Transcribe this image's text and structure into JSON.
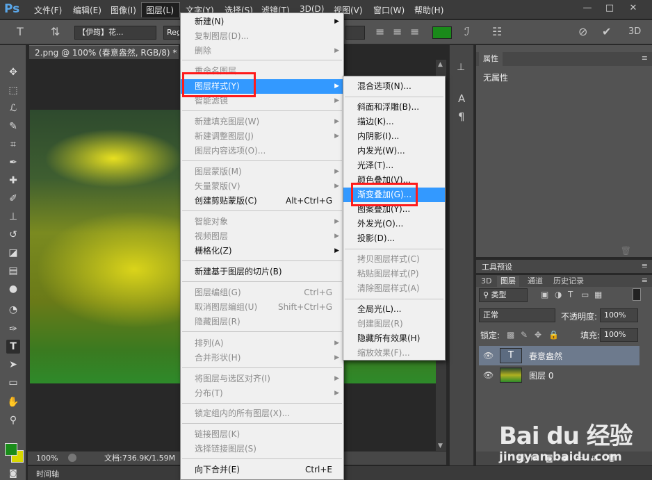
{
  "app": {
    "logo": "Ps"
  },
  "menubar": {
    "items": [
      "文件(F)",
      "编辑(E)",
      "图像(I)",
      "图层(L)",
      "文字(Y)",
      "选择(S)",
      "滤镜(T)",
      "3D(D)",
      "视图(V)",
      "窗口(W)",
      "帮助(H)"
    ],
    "window_controls": [
      "—",
      "□",
      "✕"
    ]
  },
  "options": {
    "font_family": "【伊筠】花...",
    "font_style": "Reg",
    "text_color": "#1a8a1a"
  },
  "document": {
    "tab_title": "2.png @ 100% (春意盎然, RGB/8) *",
    "tab_close": "×",
    "zoom": "100%",
    "doc_info": "文档:736.9K/1.59M"
  },
  "colors": {
    "foreground": "#1a8c1a",
    "background": "#d8d800"
  },
  "properties": {
    "tab": "属性",
    "empty_text": "无属性"
  },
  "tool_presets": {
    "label": "工具预设"
  },
  "layers_panel": {
    "tabs": [
      "3D",
      "图层",
      "通道",
      "历史记录"
    ],
    "active_tab": "图层",
    "filter_kind": "类型",
    "blend_mode": "正常",
    "opacity_label": "不透明度:",
    "opacity_value": "100%",
    "lock_label": "锁定:",
    "fill_label": "填充:",
    "fill_value": "100%",
    "layers": [
      {
        "name": "春意盎然",
        "type": "text",
        "thumb_glyph": "T",
        "selected": true
      },
      {
        "name": "图层 0",
        "type": "image",
        "selected": false
      }
    ]
  },
  "timeline": {
    "label": "时间轴"
  },
  "layer_menu": {
    "items": [
      {
        "label": "新建(N)",
        "submenu": true
      },
      {
        "label": "复制图层(D)...",
        "disabled": true
      },
      {
        "label": "删除",
        "disabled": true,
        "submenu": true
      },
      {
        "label": "重命名图层...",
        "disabled": true
      },
      {
        "label": "图层样式(Y)",
        "submenu": true,
        "highlighted": true
      },
      {
        "label": "智能滤镜",
        "disabled": true,
        "submenu": true
      },
      {
        "label": "新建填充图层(W)",
        "disabled": true,
        "submenu": true
      },
      {
        "label": "新建调整图层(J)",
        "disabled": true,
        "submenu": true
      },
      {
        "label": "图层内容选项(O)...",
        "disabled": true
      },
      {
        "label": "图层蒙版(M)",
        "disabled": true,
        "submenu": true
      },
      {
        "label": "矢量蒙版(V)",
        "disabled": true,
        "submenu": true
      },
      {
        "label": "创建剪贴蒙版(C)",
        "shortcut": "Alt+Ctrl+G"
      },
      {
        "label": "智能对象",
        "disabled": true,
        "submenu": true
      },
      {
        "label": "视频图层",
        "disabled": true,
        "submenu": true
      },
      {
        "label": "栅格化(Z)",
        "submenu": true
      },
      {
        "label": "新建基于图层的切片(B)"
      },
      {
        "label": "图层编组(G)",
        "disabled": true,
        "shortcut": "Ctrl+G"
      },
      {
        "label": "取消图层编组(U)",
        "disabled": true,
        "shortcut": "Shift+Ctrl+G"
      },
      {
        "label": "隐藏图层(R)",
        "disabled": true
      },
      {
        "label": "排列(A)",
        "disabled": true,
        "submenu": true
      },
      {
        "label": "合并形状(H)",
        "disabled": true,
        "submenu": true
      },
      {
        "label": "将图层与选区对齐(I)",
        "disabled": true,
        "submenu": true
      },
      {
        "label": "分布(T)",
        "disabled": true,
        "submenu": true
      },
      {
        "label": "锁定组内的所有图层(X)...",
        "disabled": true
      },
      {
        "label": "链接图层(K)",
        "disabled": true
      },
      {
        "label": "选择链接图层(S)",
        "disabled": true
      },
      {
        "label": "向下合并(E)",
        "shortcut": "Ctrl+E"
      }
    ]
  },
  "style_submenu": {
    "items": [
      {
        "label": "混合选项(N)..."
      },
      {
        "label": "斜面和浮雕(B)..."
      },
      {
        "label": "描边(K)..."
      },
      {
        "label": "内阴影(I)..."
      },
      {
        "label": "内发光(W)..."
      },
      {
        "label": "光泽(T)..."
      },
      {
        "label": "颜色叠加(V)..."
      },
      {
        "label": "渐变叠加(G)...",
        "highlighted": true
      },
      {
        "label": "图案叠加(Y)..."
      },
      {
        "label": "外发光(O)..."
      },
      {
        "label": "投影(D)..."
      },
      {
        "label": "拷贝图层样式(C)",
        "disabled": true
      },
      {
        "label": "粘贴图层样式(P)",
        "disabled": true
      },
      {
        "label": "清除图层样式(A)",
        "disabled": true
      },
      {
        "label": "全局光(L)..."
      },
      {
        "label": "创建图层(R)",
        "disabled": true
      },
      {
        "label": "隐藏所有效果(H)"
      },
      {
        "label": "缩放效果(F)...",
        "disabled": true
      }
    ]
  },
  "watermark": {
    "logo": "Bai du 经验",
    "url": "jingyan.baidu.com"
  }
}
